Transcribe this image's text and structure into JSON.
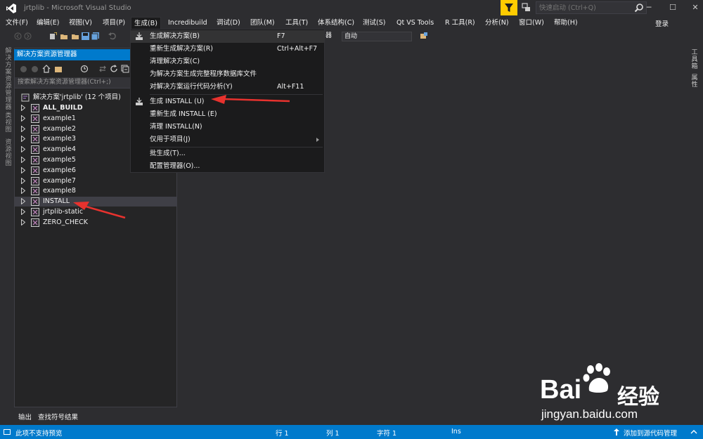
{
  "window": {
    "title": "jrtplib - Microsoft Visual Studio",
    "quick_launch_placeholder": "快速启动 (Ctrl+Q)",
    "login": "登录",
    "minimize": "─",
    "maximize": "☐",
    "close": "✕"
  },
  "menu": [
    "文件(F)",
    "编辑(E)",
    "视图(V)",
    "项目(P)",
    "生成(B)",
    "Incredibuild",
    "调试(D)",
    "团队(M)",
    "工具(T)",
    "体系结构(C)",
    "测试(S)",
    "Qt VS Tools",
    "R 工具(R)",
    "分析(N)",
    "窗口(W)",
    "帮助(H)"
  ],
  "toolbar": {
    "config_suffix": "器",
    "platform": "自动"
  },
  "left_tabs": [
    "解决方案资源管理器",
    "类视图",
    "资源视图"
  ],
  "right_tabs": [
    "工具箱",
    "属性"
  ],
  "solution_explorer": {
    "title": "解决方案资源管理器",
    "search_placeholder": "搜索解决方案资源管理器(Ctrl+;)",
    "solution_label": "解决方案'jrtplib' (12 个项目)",
    "items": [
      {
        "label": "ALL_BUILD"
      },
      {
        "label": "example1"
      },
      {
        "label": "example2"
      },
      {
        "label": "example3"
      },
      {
        "label": "example4"
      },
      {
        "label": "example5"
      },
      {
        "label": "example6"
      },
      {
        "label": "example7"
      },
      {
        "label": "example8"
      },
      {
        "label": "INSTALL"
      },
      {
        "label": "jrtplib-static"
      },
      {
        "label": "ZERO_CHECK"
      }
    ]
  },
  "bottom_tabs": [
    "输出",
    "查找符号结果"
  ],
  "build_menu": [
    {
      "label": "生成解决方案(B)",
      "shortcut": "F7"
    },
    {
      "label": "重新生成解决方案(R)",
      "shortcut": "Ctrl+Alt+F7"
    },
    {
      "label": "清理解决方案(C)",
      "shortcut": ""
    },
    {
      "label": "为解决方案生成完整程序数据库文件",
      "shortcut": ""
    },
    {
      "label": "对解决方案运行代码分析(Y)",
      "shortcut": "Alt+F11"
    },
    {
      "label": "生成 INSTALL (U)",
      "shortcut": ""
    },
    {
      "label": "重新生成 INSTALL (E)",
      "shortcut": ""
    },
    {
      "label": "清理 INSTALL(N)",
      "shortcut": ""
    },
    {
      "label": "仅用于项目(J)",
      "shortcut": ""
    },
    {
      "label": "批生成(T)...",
      "shortcut": ""
    },
    {
      "label": "配置管理器(O)...",
      "shortcut": ""
    }
  ],
  "status": {
    "message": "此项不支持预览",
    "line": "行 1",
    "col": "列 1",
    "char": "字符 1",
    "ins": "Ins",
    "source_control": "添加到源代码管理"
  },
  "watermark": {
    "brand_a": "Bai",
    "brand_b": "经验",
    "url": "jingyan.baidu.com"
  },
  "colors": {
    "accent": "#007acc",
    "annotation": "#e8322e",
    "background": "#2d2d30"
  }
}
